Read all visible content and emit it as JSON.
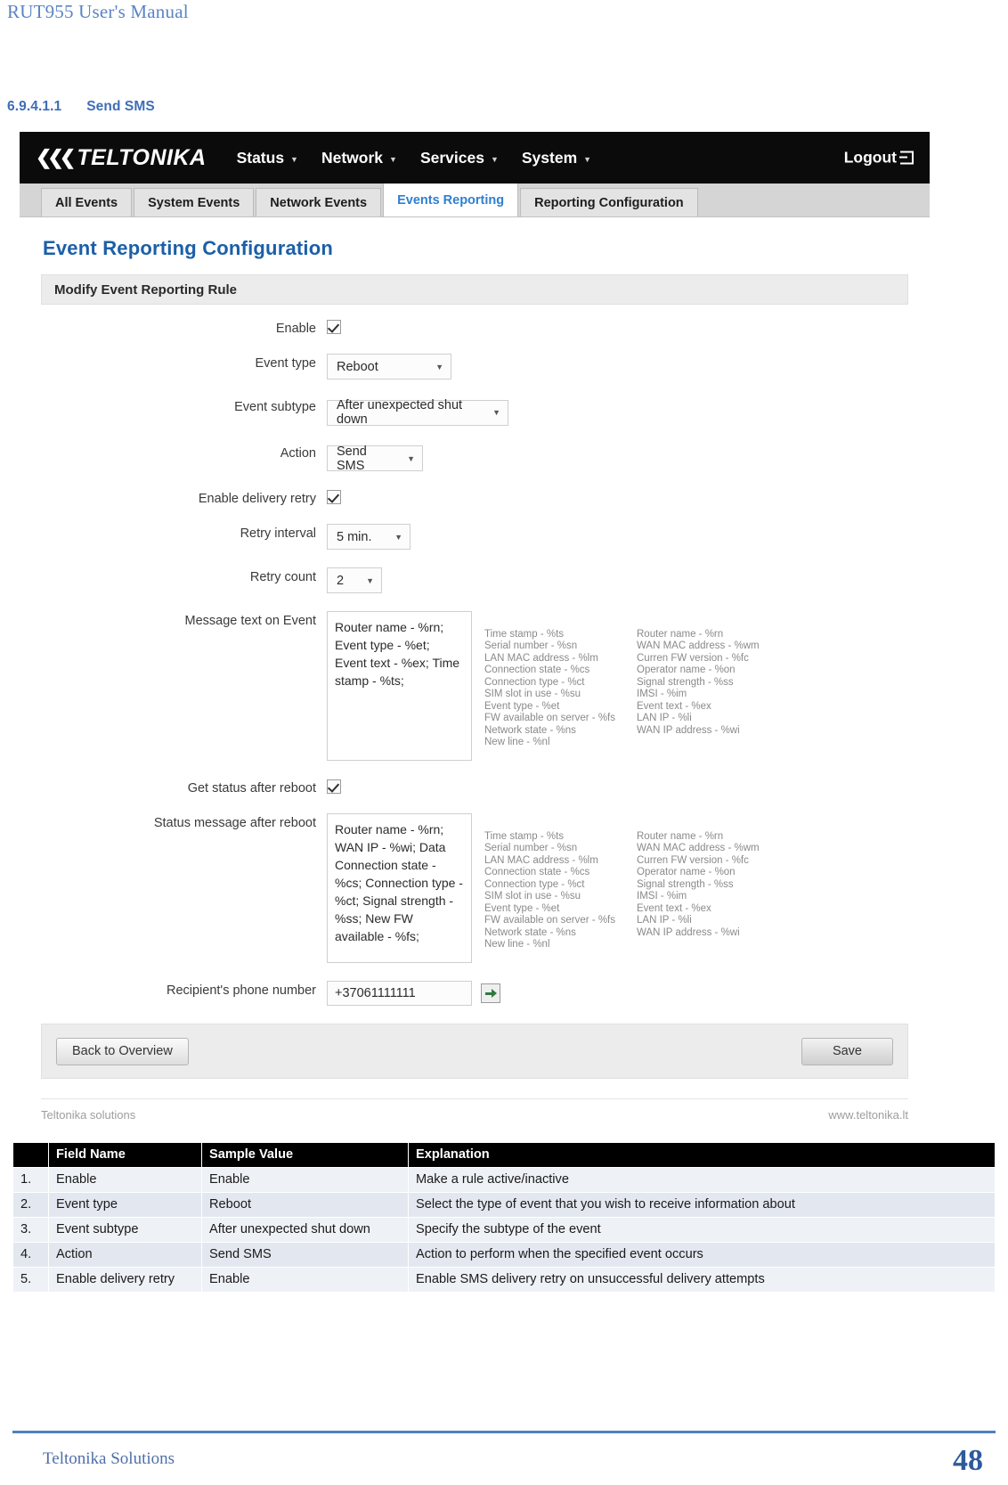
{
  "document": {
    "running_header": "RUT955 User's Manual",
    "section_number": "6.9.4.1.1",
    "section_title": "Send SMS",
    "footer_left": "Teltonika Solutions",
    "page_number": "48"
  },
  "screenshot": {
    "brand": "TELTONIKA",
    "nav": [
      {
        "label": "Status"
      },
      {
        "label": "Network"
      },
      {
        "label": "Services"
      },
      {
        "label": "System"
      }
    ],
    "logout_label": "Logout",
    "tabs": [
      {
        "label": "All Events",
        "active": false
      },
      {
        "label": "System Events",
        "active": false
      },
      {
        "label": "Network Events",
        "active": false
      },
      {
        "label": "Events Reporting",
        "active": true
      },
      {
        "label": "Reporting Configuration",
        "active": false
      }
    ],
    "page_title": "Event Reporting Configuration",
    "panel_title": "Modify Event Reporting Rule",
    "fields": {
      "enable_label": "Enable",
      "enable_checked": true,
      "event_type_label": "Event type",
      "event_type_value": "Reboot",
      "event_subtype_label": "Event subtype",
      "event_subtype_value": "After unexpected shut down",
      "action_label": "Action",
      "action_value": "Send SMS",
      "enable_retry_label": "Enable delivery retry",
      "enable_retry_checked": true,
      "retry_interval_label": "Retry interval",
      "retry_interval_value": "5 min.",
      "retry_count_label": "Retry count",
      "retry_count_value": "2",
      "message_text_label": "Message text on Event",
      "message_text_value": "Router name - %rn; Event type - %et; Event text - %ex; Time stamp - %ts;",
      "get_status_label": "Get status after reboot",
      "get_status_checked": true,
      "status_message_label": "Status message after reboot",
      "status_message_value": "Router name - %rn; WAN IP - %wi; Data Connection state - %cs; Connection type - %ct; Signal strength - %ss; New FW available - %fs;",
      "phone_label": "Recipient's phone number",
      "phone_value": "+37061111111"
    },
    "hints_left": "Time stamp - %ts\nSerial number - %sn\nLAN MAC address - %lm\nConnection state - %cs\nConnection type - %ct\nSIM slot in use - %su\nEvent type - %et\nFW available on server - %fs\nNetwork state - %ns\nNew line - %nl",
    "hints_right": "Router name - %rn\nWAN MAC address - %wm\nCurren FW version - %fc\nOperator name - %on\nSignal strength - %ss\nIMSI - %im\nEvent text - %ex\nLAN IP - %li\nWAN IP address - %wi",
    "back_button": "Back to Overview",
    "save_button": "Save",
    "footer_left": "Teltonika solutions",
    "footer_right": "www.teltonika.lt"
  },
  "table": {
    "headers": [
      "",
      "Field Name",
      "Sample Value",
      "Explanation"
    ],
    "rows": [
      {
        "index": "1.",
        "field": "Enable",
        "sample": "Enable",
        "explanation": "Make a rule active/inactive"
      },
      {
        "index": "2.",
        "field": "Event type",
        "sample": "Reboot",
        "explanation": "Select the type of event that you wish to receive information about"
      },
      {
        "index": "3.",
        "field": "Event subtype",
        "sample": "After unexpected shut down",
        "explanation": "Specify the subtype of the event"
      },
      {
        "index": "4.",
        "field": "Action",
        "sample": "Send SMS",
        "explanation": "Action to perform when the specified event occurs"
      },
      {
        "index": "5.",
        "field": "Enable delivery retry",
        "sample": "Enable",
        "explanation": "Enable SMS delivery retry on unsuccessful delivery attempts"
      }
    ]
  }
}
